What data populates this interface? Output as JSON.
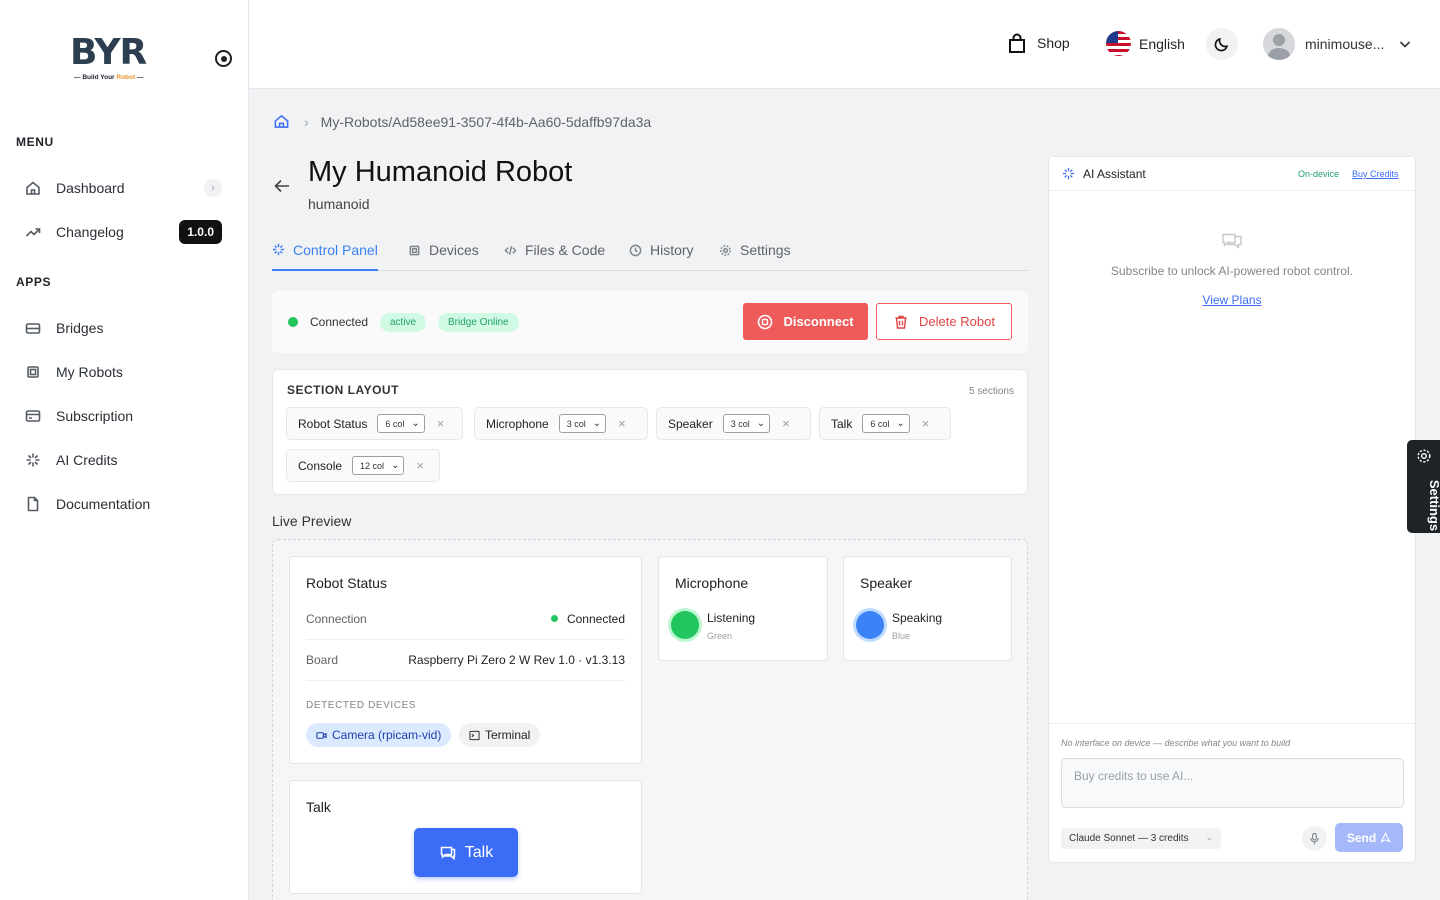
{
  "app": {
    "logo_text": "BYR",
    "logo_tagline_1": "Build Your",
    "logo_tagline_2": "Robot"
  },
  "sidebar": {
    "menu_label": "MENU",
    "apps_label": "APPS",
    "menu_items": [
      {
        "label": "Dashboard",
        "icon": "home-icon"
      },
      {
        "label": "Changelog",
        "icon": "trend-icon",
        "badge": "1.0.0"
      }
    ],
    "app_items": [
      {
        "label": "Bridges",
        "icon": "bridge-icon"
      },
      {
        "label": "My Robots",
        "icon": "chip-icon"
      },
      {
        "label": "Subscription",
        "icon": "card-icon"
      },
      {
        "label": "AI Credits",
        "icon": "sparkle-icon"
      },
      {
        "label": "Documentation",
        "icon": "document-icon"
      }
    ]
  },
  "topbar": {
    "shop_label": "Shop",
    "language_label": "English",
    "username": "minimouse..."
  },
  "breadcrumb": {
    "path": "My-Robots/Ad58ee91-3507-4f4b-Aa60-5daffb97da3a"
  },
  "robot": {
    "title": "My Humanoid Robot",
    "subtitle": "humanoid"
  },
  "tabs": [
    {
      "label": "Control Panel",
      "active": true
    },
    {
      "label": "Devices",
      "active": false
    },
    {
      "label": "Files & Code",
      "active": false
    },
    {
      "label": "History",
      "active": false
    },
    {
      "label": "Settings",
      "active": false
    }
  ],
  "connection": {
    "status": "Connected",
    "pill_active": "active",
    "pill_bridge": "Bridge Online",
    "disconnect_label": "Disconnect",
    "delete_label": "Delete Robot"
  },
  "section_layout": {
    "title": "SECTION LAYOUT",
    "count": "5 sections",
    "sections": [
      {
        "name": "Robot Status",
        "cols": "6 col"
      },
      {
        "name": "Microphone",
        "cols": "3 col"
      },
      {
        "name": "Speaker",
        "cols": "3 col"
      },
      {
        "name": "Talk",
        "cols": "6 col"
      },
      {
        "name": "Console",
        "cols": "12 col"
      }
    ]
  },
  "live_preview": {
    "label": "Live Preview",
    "robot_status": {
      "title": "Robot Status",
      "connection_key": "Connection",
      "connection_value": "Connected",
      "board_key": "Board",
      "board_value": "Raspberry Pi Zero 2 W Rev 1.0 · v1.3.13",
      "detected_label": "DETECTED DEVICES",
      "devices": [
        "Camera (rpicam-vid)",
        "Terminal"
      ]
    },
    "microphone": {
      "title": "Microphone",
      "state": "Listening",
      "color_name": "Green",
      "color": "#22c55e"
    },
    "speaker": {
      "title": "Speaker",
      "state": "Speaking",
      "color_name": "Blue",
      "color": "#3b82f6"
    },
    "talk": {
      "title": "Talk",
      "button_label": "Talk"
    }
  },
  "ai_assistant": {
    "title": "AI Assistant",
    "on_device": "On-device",
    "buy_credits": "Buy Credits",
    "message": "Subscribe to unlock AI-powered robot control.",
    "view_plans": "View Plans",
    "hint": "No interface on device — describe what you want to build",
    "input_placeholder": "Buy credits to use AI...",
    "model": "Claude Sonnet — 3 credits",
    "send_label": "Send"
  },
  "settings_tab": {
    "label": "Settings"
  },
  "colors": {
    "accent": "#3b82f6",
    "danger": "#ef5a5a",
    "success": "#22c55e"
  }
}
